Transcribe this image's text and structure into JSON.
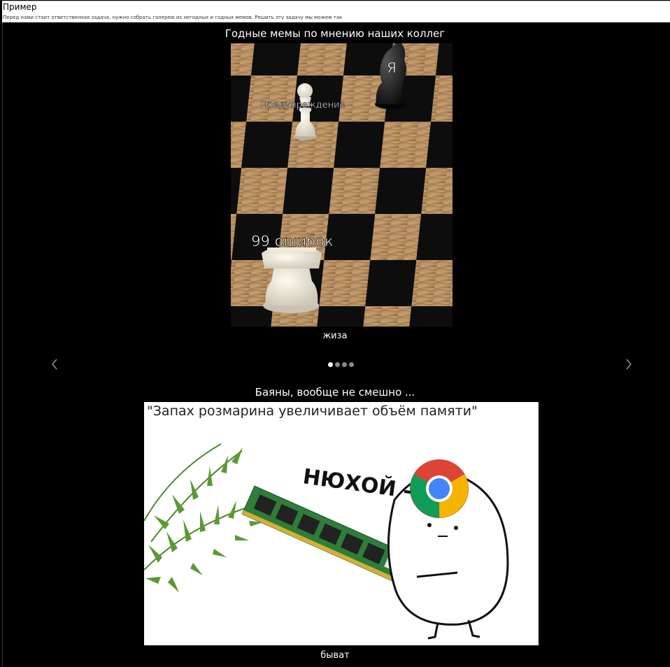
{
  "header": {
    "title": "Пример",
    "description": "Перед нами стоит ответственная задача, нужно собрать галерею из негодных и годных мемов. Решить эту задачу мы можем так"
  },
  "gallery_good": {
    "title": "Годные мемы по мнению наших коллег",
    "meme": {
      "label_top": "Я",
      "label_middle": "Предупреждение",
      "label_bottom": "99 ошибок"
    },
    "caption": "жиза",
    "slides_count": 4,
    "active_slide": 1
  },
  "gallery_bad": {
    "title": "Баяны, вообще не смешно ...",
    "meme": {
      "quote": "\"Запах розмарина увеличивает объём памяти\"",
      "sniff_text": "НЮХОЙ -"
    },
    "caption": "быват"
  },
  "colors": {
    "background": "#000000",
    "header_background": "#ffffff",
    "dot_active": "#ffffff",
    "dot_inactive": "#888888"
  }
}
